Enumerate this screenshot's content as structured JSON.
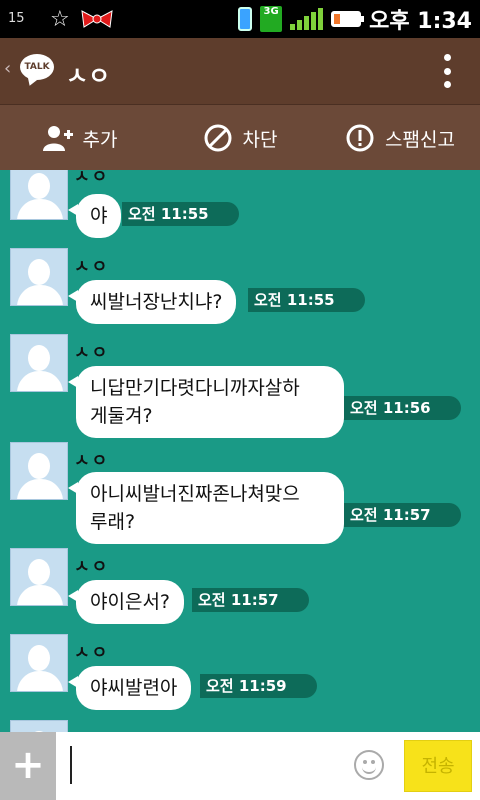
{
  "status_bar": {
    "left_number": "15",
    "network": "3G",
    "clock": "오후 1:34"
  },
  "header": {
    "back_icon": "chevron-left-icon",
    "app_badge": "TALK",
    "title": "ㅅㅇ",
    "menu_icon": "more-vertical-icon"
  },
  "actions": [
    {
      "label": "추가",
      "icon": "add-friend-icon"
    },
    {
      "label": "차단",
      "icon": "block-icon"
    },
    {
      "label": "스팸신고",
      "icon": "report-icon"
    }
  ],
  "messages": [
    {
      "sender": "ㅅㅇ",
      "lines": [
        "야"
      ],
      "time": "오전 11:55"
    },
    {
      "sender": "ㅅㅇ",
      "lines": [
        "씨발너장난치냐?"
      ],
      "time": "오전 11:55"
    },
    {
      "sender": "ㅅㅇ",
      "lines": [
        "니답만기다렷다니까자살하",
        "게둘겨?"
      ],
      "time": "오전 11:56"
    },
    {
      "sender": "ㅅㅇ",
      "lines": [
        "아니씨발너진짜존나쳐맞으",
        "루래?"
      ],
      "time": "오전 11:57"
    },
    {
      "sender": "ㅅㅇ",
      "lines": [
        "야이은서?"
      ],
      "time": "오전 11:57"
    },
    {
      "sender": "ㅅㅇ",
      "lines": [
        "야씨발련아"
      ],
      "time": "오전 11:59"
    }
  ],
  "input_bar": {
    "plus_label": "+",
    "input_value": "",
    "send_label": "전송"
  },
  "colors": {
    "chat_background": "#1a9a86",
    "header": "#5e3d2c",
    "time_badge": "#0d6b59",
    "send_button": "#f7e21a"
  }
}
